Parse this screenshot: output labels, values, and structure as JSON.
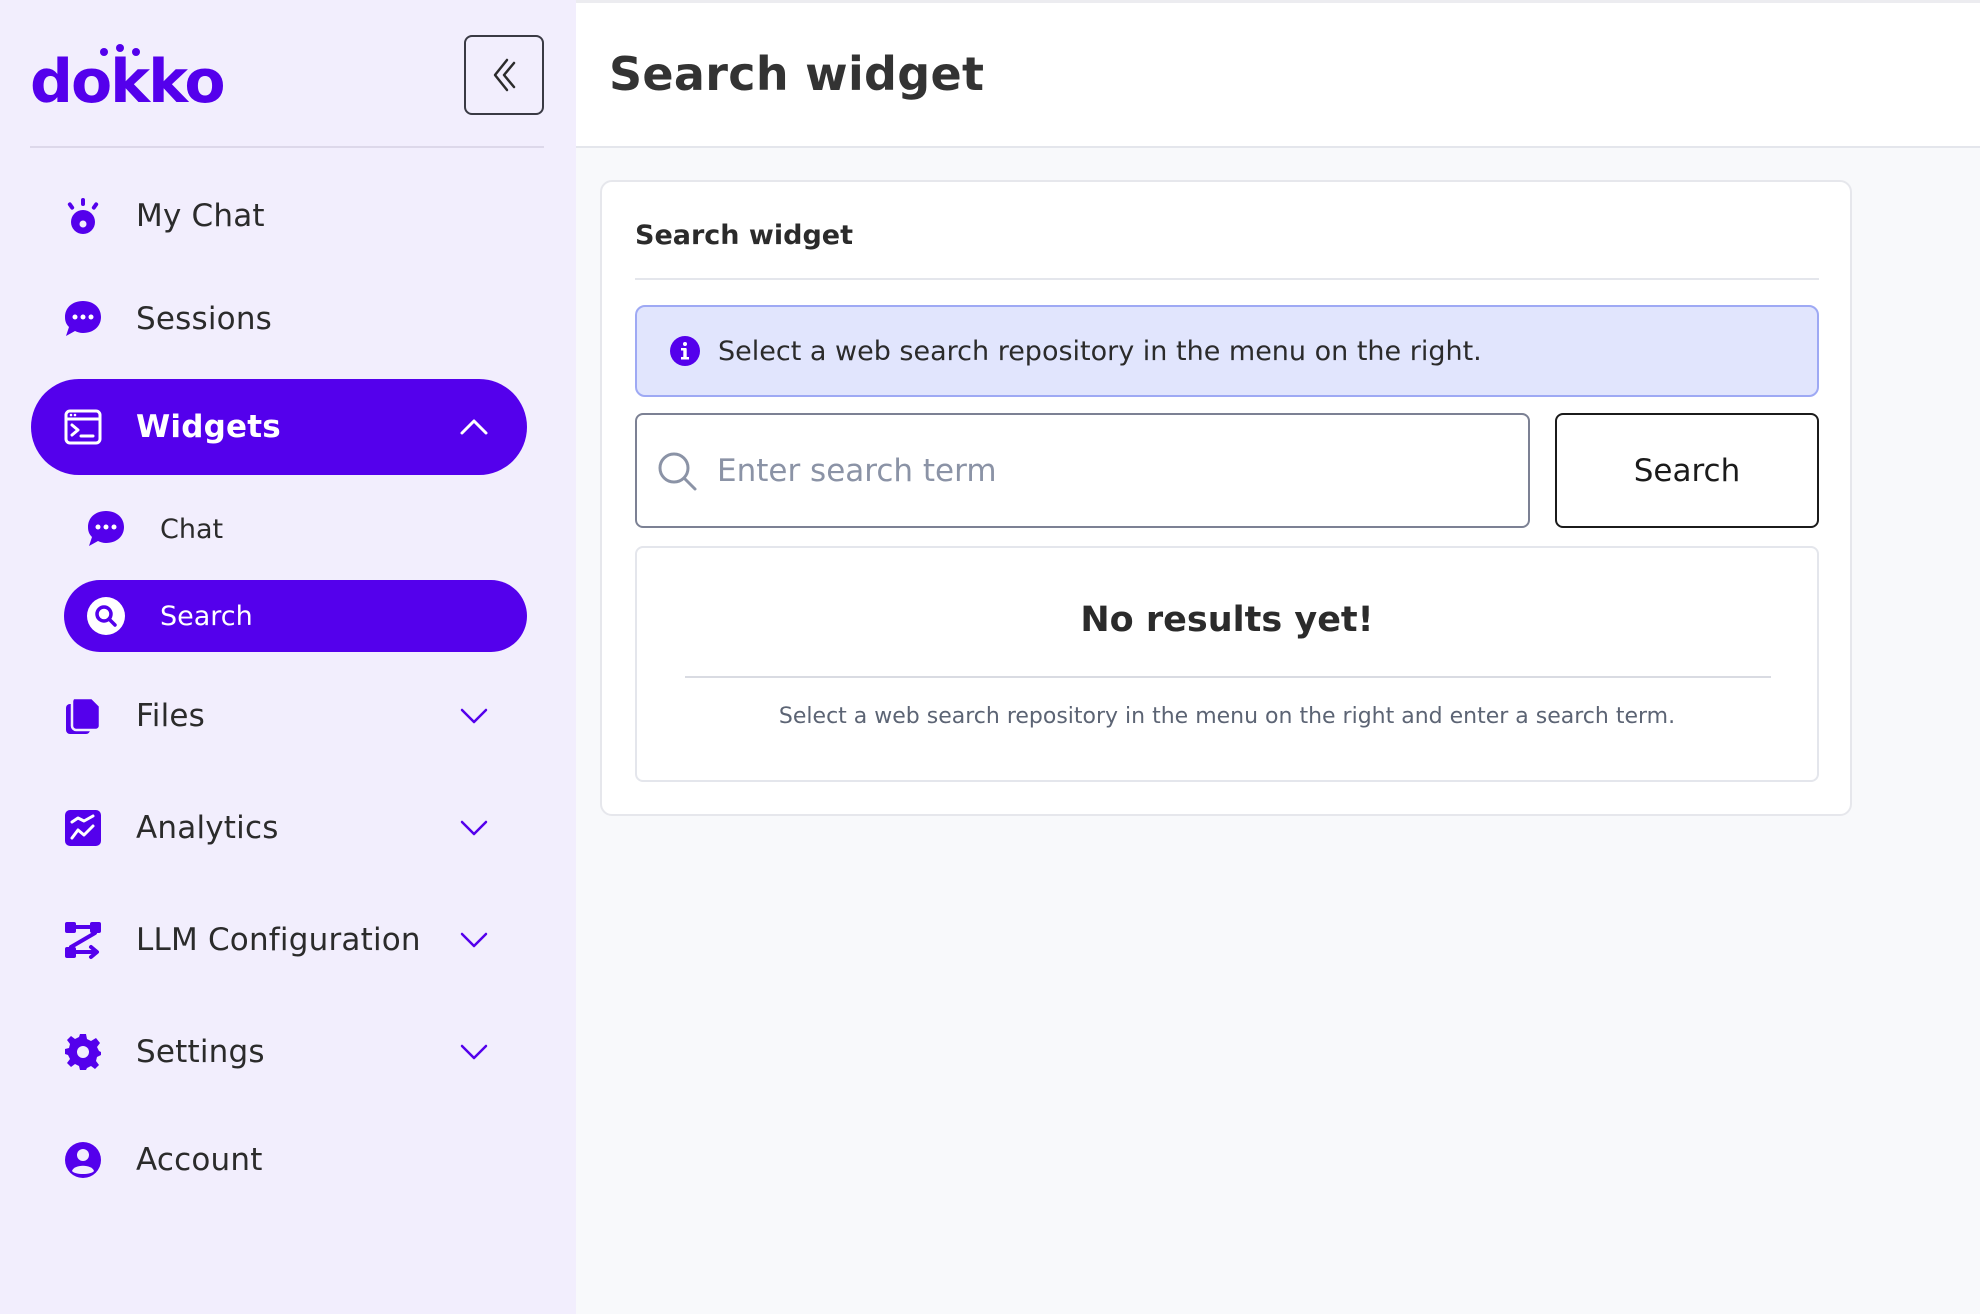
{
  "brand": {
    "logo_text": "dokko",
    "accent_color": "#5400ec",
    "sidebar_bg": "#f2eefd"
  },
  "sidebar": {
    "collapse_icon": "chevrons-left-icon",
    "items": [
      {
        "label": "My Chat",
        "icon": "dokko-mascot-icon",
        "active": false,
        "expandable": false
      },
      {
        "label": "Sessions",
        "icon": "chat-bubble-icon",
        "active": false,
        "expandable": false
      },
      {
        "label": "Widgets",
        "icon": "terminal-window-icon",
        "active": true,
        "expandable": true,
        "expanded": true,
        "children": [
          {
            "label": "Chat",
            "icon": "chat-bubble-icon",
            "active": false
          },
          {
            "label": "Search",
            "icon": "search-circle-icon",
            "active": true
          }
        ]
      },
      {
        "label": "Files",
        "icon": "documents-icon",
        "active": false,
        "expandable": true,
        "expanded": false
      },
      {
        "label": "Analytics",
        "icon": "chart-icon",
        "active": false,
        "expandable": true,
        "expanded": false
      },
      {
        "label": "LLM Configuration",
        "icon": "workflow-icon",
        "active": false,
        "expandable": true,
        "expanded": false
      },
      {
        "label": "Settings",
        "icon": "gear-icon",
        "active": false,
        "expandable": true,
        "expanded": false
      },
      {
        "label": "Account",
        "icon": "user-circle-icon",
        "active": false,
        "expandable": false
      }
    ]
  },
  "header": {
    "title": "Search widget"
  },
  "card": {
    "title": "Search widget",
    "info_message": "Select a web search repository in the menu on the right.",
    "search": {
      "placeholder": "Enter search term",
      "value": "",
      "button_label": "Search"
    },
    "results": {
      "title": "No results yet!",
      "message": "Select a web search repository in the menu on the right and enter a search term."
    }
  }
}
